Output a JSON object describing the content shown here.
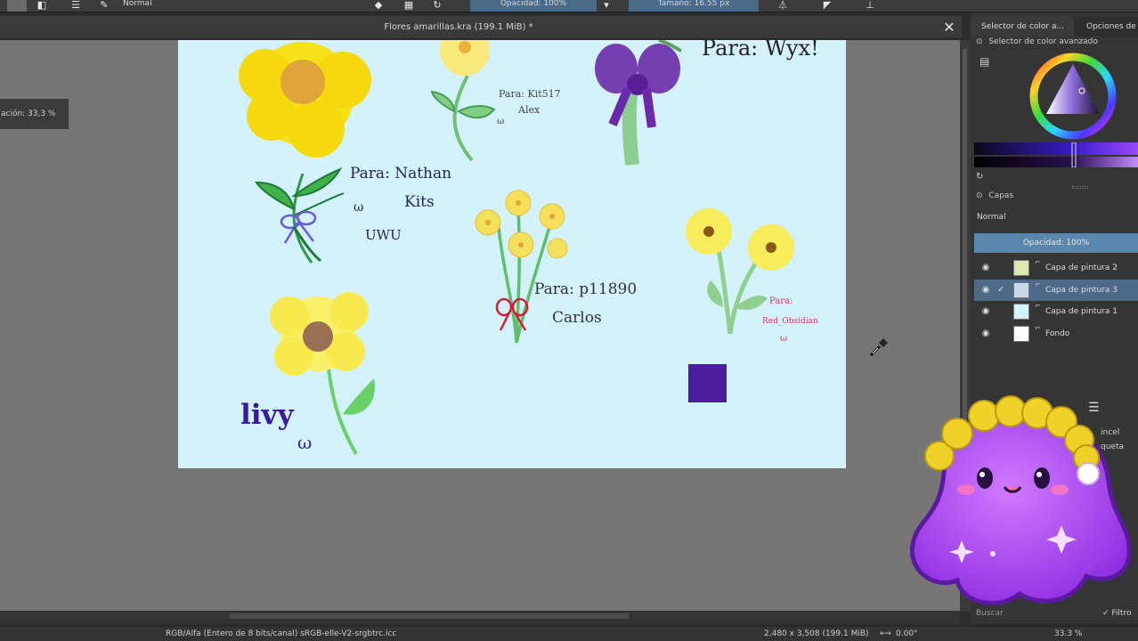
{
  "toolbar": {
    "blend_mode": "Normal",
    "opacity_label": "Opacidad: 100%",
    "size_label": "Tamaño: 16.55 px"
  },
  "document": {
    "title": "Flores amarillas.kra (199.1 MiB) *",
    "close_glyph": "✕"
  },
  "zoom_popup": "ación: 33,3 %",
  "canvas": {
    "notes": {
      "wyx": "Para: Wyx!",
      "kit517_line1": "Para: Kit517",
      "kit517_line2": "Alex",
      "nathan_line1": "Para: Nathan",
      "nathan_line2": "Kits",
      "nathan_face": "ω",
      "nathan_uwu": "UWU",
      "p11890_line1": "Para: p11890",
      "p11890_line2": "Carlos",
      "red_line1": "Para:",
      "red_line2": "Red_Obsidian",
      "red_face": "ω",
      "livy": "livy",
      "livy_face": "ω",
      "kit_face": "ω"
    }
  },
  "status": {
    "color_space": "RGB/Alfa (Entero de 8 bits/canal)  sRGB-elle-V2-srgbtrc.icc",
    "dimensions": "2,480 x 3,508 (199.1 MiB)",
    "rotation": "0.00°",
    "zoom": "33.3 %"
  },
  "dock": {
    "tab_color": "Selector de color a...",
    "tab_options": "Opciones de",
    "color_panel_title": "Selector de color avanzado",
    "layers_title": "Capas",
    "blend_mode": "Normal",
    "opacity": "Opacidad:  100%",
    "layers": [
      {
        "name": "Capa de pintura 2",
        "visible": true,
        "active": false,
        "thumb": "#dfe8b0"
      },
      {
        "name": "Capa de pintura 3",
        "visible": true,
        "active": true,
        "thumb": "#c8d8e8"
      },
      {
        "name": "Capa de pintura 1",
        "visible": true,
        "active": false,
        "thumb": "#d3f2fb"
      },
      {
        "name": "Fondo",
        "visible": true,
        "active": false,
        "thumb": "#ffffff"
      }
    ],
    "brush_label_1": "incel",
    "brush_label_2": "queta",
    "search_placeholder": "Buscar",
    "filter_label": "✓ Filtro"
  },
  "icons": {
    "close": "close-icon",
    "eye": "eye-icon",
    "picker": "color-picker-cursor-icon"
  },
  "colors": {
    "canvas": "#d3f2fb",
    "accent": "#5a86ad",
    "active_layer": "#4d6a88",
    "swatch": "#4b1c9c"
  }
}
